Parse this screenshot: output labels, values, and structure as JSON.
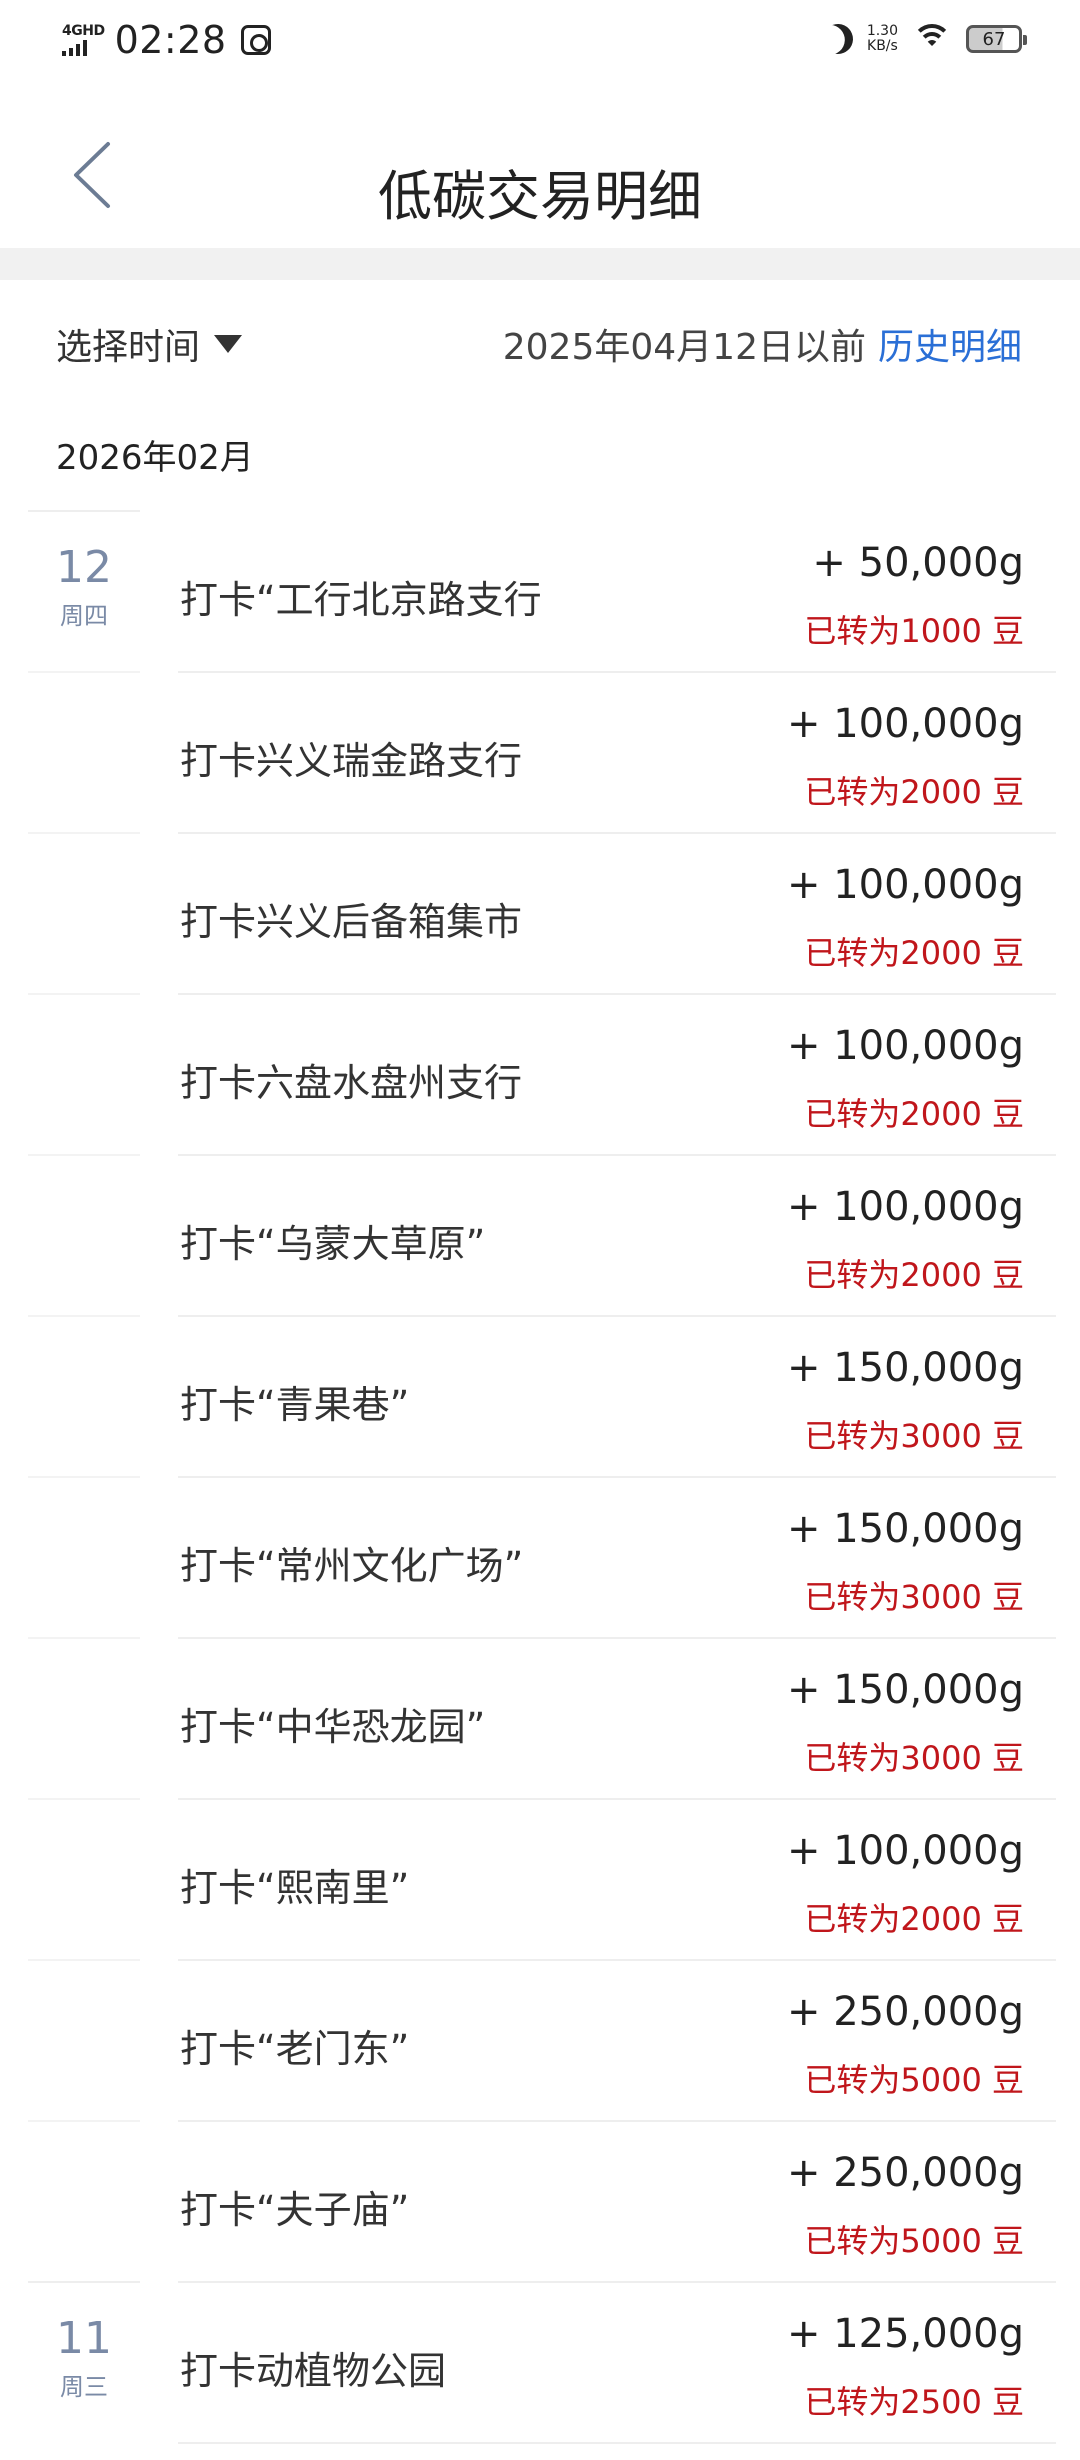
{
  "status_bar": {
    "network": "4GHD",
    "time": "02:28",
    "speed_value": "1.30",
    "speed_unit": "KB/s",
    "battery": "67"
  },
  "header": {
    "title": "低碳交易明细"
  },
  "filter": {
    "select_time_label": "选择时间",
    "before_text": "2025年04月12日以前",
    "history_label": "历史明细"
  },
  "month_heading": "2026年02月",
  "colors": {
    "accent_blue": "#2a6fd6",
    "converted_red": "#c0161b",
    "date_gray_blue": "#7a8aa6"
  },
  "records": [
    {
      "day": "12",
      "weekday": "周四",
      "title": "打卡“工行北京路支行",
      "amount": "+ 50,000g",
      "converted": "已转为1000 豆"
    },
    {
      "day": "",
      "weekday": "",
      "title": "打卡兴义瑞金路支行",
      "amount": "+ 100,000g",
      "converted": "已转为2000 豆"
    },
    {
      "day": "",
      "weekday": "",
      "title": "打卡兴义后备箱集市",
      "amount": "+ 100,000g",
      "converted": "已转为2000 豆"
    },
    {
      "day": "",
      "weekday": "",
      "title": "打卡六盘水盘州支行",
      "amount": "+ 100,000g",
      "converted": "已转为2000 豆"
    },
    {
      "day": "",
      "weekday": "",
      "title": "打卡“乌蒙大草原”",
      "amount": "+ 100,000g",
      "converted": "已转为2000 豆"
    },
    {
      "day": "",
      "weekday": "",
      "title": "打卡“青果巷”",
      "amount": "+ 150,000g",
      "converted": "已转为3000 豆"
    },
    {
      "day": "",
      "weekday": "",
      "title": "打卡“常州文化广场”",
      "amount": "+ 150,000g",
      "converted": "已转为3000 豆"
    },
    {
      "day": "",
      "weekday": "",
      "title": "打卡“中华恐龙园”",
      "amount": "+ 150,000g",
      "converted": "已转为3000 豆"
    },
    {
      "day": "",
      "weekday": "",
      "title": "打卡“熙南里”",
      "amount": "+ 100,000g",
      "converted": "已转为2000 豆"
    },
    {
      "day": "",
      "weekday": "",
      "title": "打卡“老门东”",
      "amount": "+ 250,000g",
      "converted": "已转为5000 豆"
    },
    {
      "day": "",
      "weekday": "",
      "title": "打卡“夫子庙”",
      "amount": "+ 250,000g",
      "converted": "已转为5000 豆"
    },
    {
      "day": "11",
      "weekday": "周三",
      "title": "打卡动植物公园",
      "amount": "+ 125,000g",
      "converted": "已转为2500 豆"
    }
  ]
}
